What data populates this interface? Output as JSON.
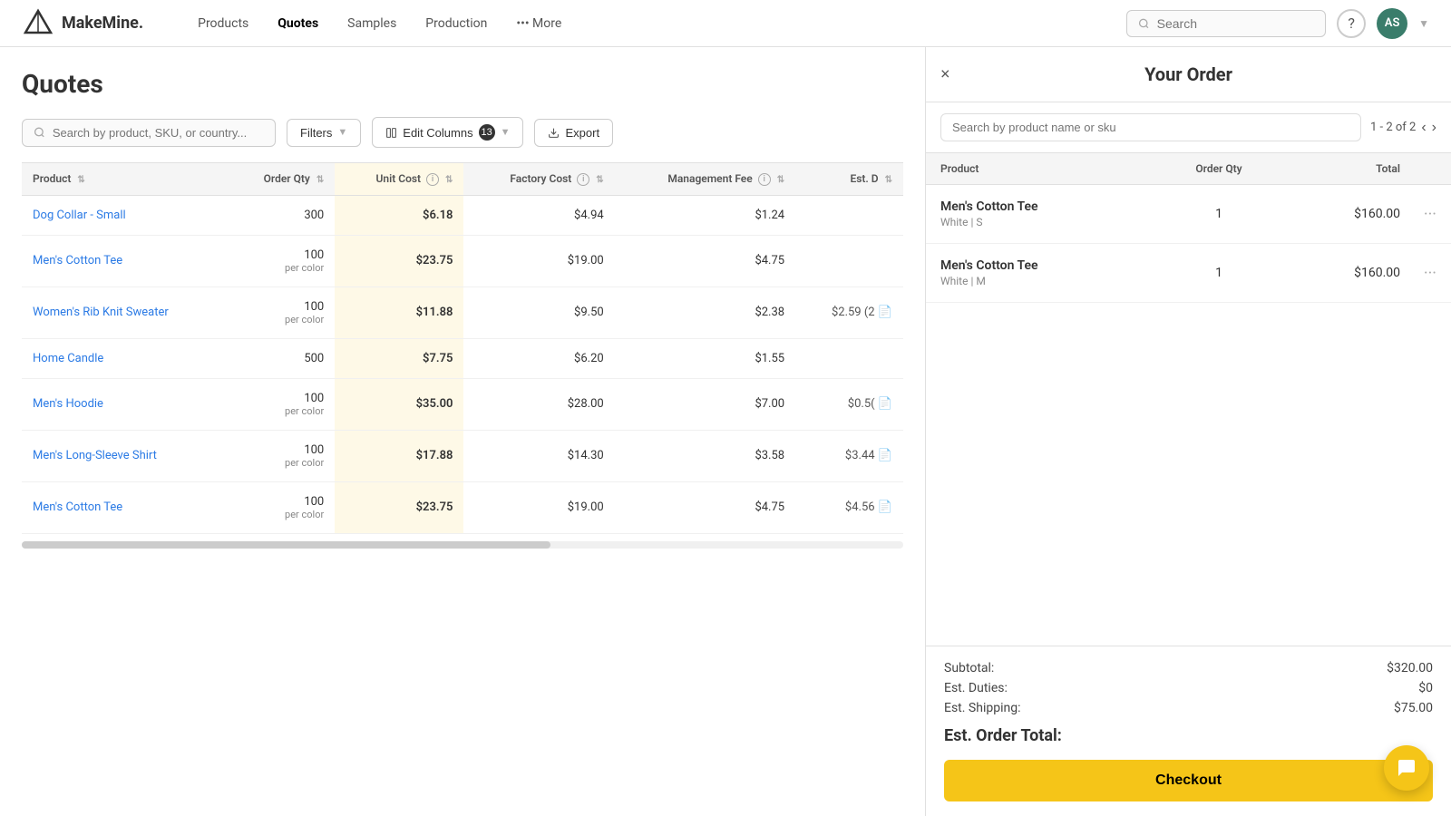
{
  "brand": {
    "name": "MakeMine."
  },
  "nav": {
    "links": [
      {
        "label": "Products",
        "active": false
      },
      {
        "label": "Quotes",
        "active": true
      },
      {
        "label": "Samples",
        "active": false
      },
      {
        "label": "Production",
        "active": false
      },
      {
        "label": "••• More",
        "active": false
      }
    ],
    "search_placeholder": "Search",
    "avatar_initials": "AS"
  },
  "quotes": {
    "page_title": "Quotes",
    "search_placeholder": "Search by product, SKU, or country...",
    "filters_label": "Filters",
    "edit_columns_label": "Edit Columns",
    "edit_columns_count": "13",
    "export_label": "Export",
    "columns": [
      {
        "key": "product",
        "label": "Product"
      },
      {
        "key": "order_qty",
        "label": "Order Qty"
      },
      {
        "key": "unit_cost",
        "label": "Unit Cost"
      },
      {
        "key": "factory_cost",
        "label": "Factory Cost"
      },
      {
        "key": "management_fee",
        "label": "Management Fee"
      },
      {
        "key": "est_d",
        "label": "Est. D"
      }
    ],
    "rows": [
      {
        "product": "Dog Collar - Small",
        "order_qty": "300",
        "per_color": false,
        "unit_cost": "$6.18",
        "factory_cost": "$4.94",
        "management_fee": "$1.24",
        "est_d": "",
        "has_doc": false
      },
      {
        "product": "Men's Cotton Tee",
        "order_qty": "100",
        "per_color": true,
        "unit_cost": "$23.75",
        "factory_cost": "$19.00",
        "management_fee": "$4.75",
        "est_d": "",
        "has_doc": false
      },
      {
        "product": "Women's Rib Knit Sweater",
        "order_qty": "100",
        "per_color": true,
        "unit_cost": "$11.88",
        "factory_cost": "$9.50",
        "management_fee": "$2.38",
        "est_d": "$2.59 (2",
        "has_doc": true
      },
      {
        "product": "Home Candle",
        "order_qty": "500",
        "per_color": false,
        "unit_cost": "$7.75",
        "factory_cost": "$6.20",
        "management_fee": "$1.55",
        "est_d": "",
        "has_doc": false
      },
      {
        "product": "Men's Hoodie",
        "order_qty": "100",
        "per_color": true,
        "unit_cost": "$35.00",
        "factory_cost": "$28.00",
        "management_fee": "$7.00",
        "est_d": "$0.5(",
        "has_doc": true
      },
      {
        "product": "Men's Long-Sleeve Shirt",
        "order_qty": "100",
        "per_color": true,
        "unit_cost": "$17.88",
        "factory_cost": "$14.30",
        "management_fee": "$3.58",
        "est_d": "$3.44",
        "has_doc": true
      },
      {
        "product": "Men's Cotton Tee",
        "order_qty": "100",
        "per_color": true,
        "unit_cost": "$23.75",
        "factory_cost": "$19.00",
        "management_fee": "$4.75",
        "est_d": "$4.56",
        "has_doc": true
      }
    ]
  },
  "order_panel": {
    "title": "Your Order",
    "close_label": "×",
    "search_placeholder": "Search by product name or sku",
    "pagination": "1 - 2 of 2",
    "columns": [
      {
        "label": "Product"
      },
      {
        "label": "Order Qty"
      },
      {
        "label": "Total"
      }
    ],
    "items": [
      {
        "name": "Men's Cotton Tee",
        "variant": "White | S",
        "qty": "1",
        "total": "$160.00"
      },
      {
        "name": "Men's Cotton Tee",
        "variant": "White | M",
        "qty": "1",
        "total": "$160.00"
      }
    ],
    "summary": {
      "subtotal_label": "Subtotal:",
      "subtotal_value": "$320.00",
      "duties_label": "Est. Duties:",
      "duties_value": "$0",
      "shipping_label": "Est. Shipping:",
      "shipping_value": "$75.00",
      "total_label": "Est. Order Total:",
      "total_value": ""
    },
    "checkout_label": "Checkout"
  }
}
